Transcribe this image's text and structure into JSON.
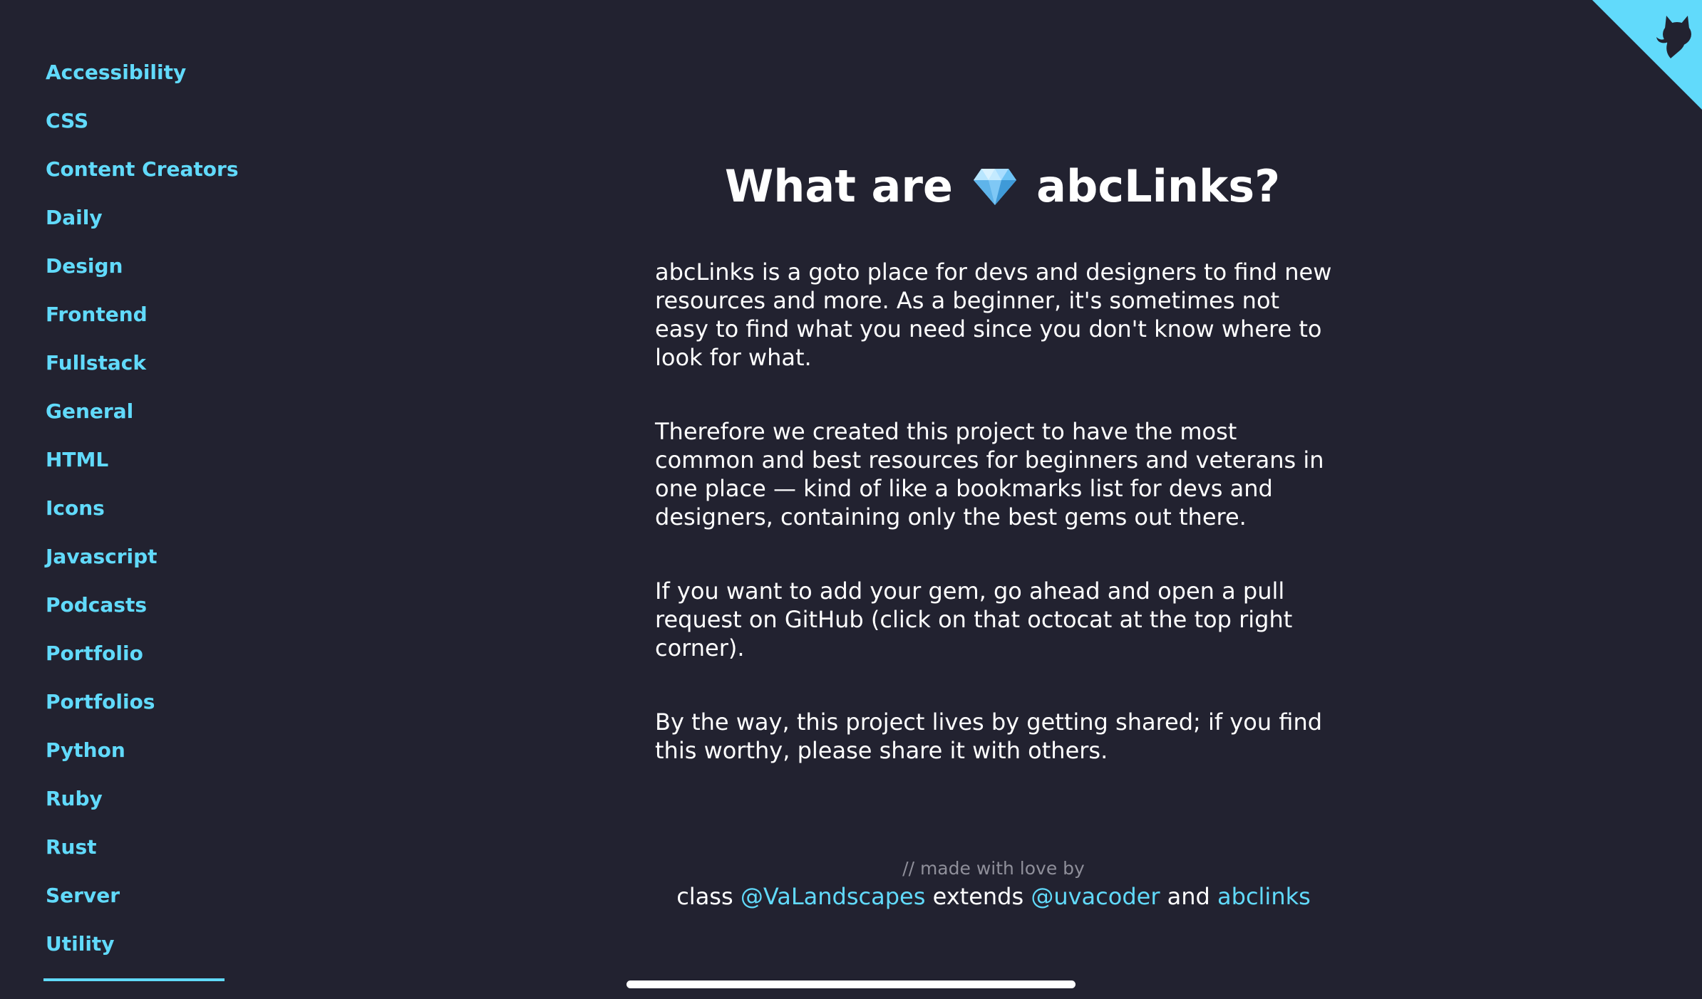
{
  "sidebar": {
    "items": [
      {
        "label": "Accessibility"
      },
      {
        "label": "CSS"
      },
      {
        "label": "Content Creators"
      },
      {
        "label": "Daily"
      },
      {
        "label": "Design"
      },
      {
        "label": "Frontend"
      },
      {
        "label": "Fullstack"
      },
      {
        "label": "General"
      },
      {
        "label": "HTML"
      },
      {
        "label": "Icons"
      },
      {
        "label": "Javascript"
      },
      {
        "label": "Podcasts"
      },
      {
        "label": "Portfolio"
      },
      {
        "label": "Portfolios"
      },
      {
        "label": "Python"
      },
      {
        "label": "Ruby"
      },
      {
        "label": "Rust"
      },
      {
        "label": "Server"
      },
      {
        "label": "Utility"
      }
    ]
  },
  "main": {
    "title_before": "What are",
    "title_after": "abcLinks?",
    "title_icon": "gem-icon",
    "paragraphs": [
      "abcLinks is a goto place for devs and designers to find new resources and more. As a beginner, it's sometimes not easy to find what you need since you don't know where to look for what.",
      "Therefore we created this project to have the most common and best resources for beginners and veterans in one place — kind of like a bookmarks list for devs and designers, containing only the best gems out there.",
      "If you want to add your gem, go ahead and open a pull request on GitHub (click on that octocat at the top right corner).",
      "By the way, this project lives by getting shared; if you find this worthy, please share it with others."
    ]
  },
  "footer": {
    "comment": "// made with love by",
    "class_kw": "class",
    "author1": "@VaLandscapes",
    "extends_kw": "extends",
    "author2": "@uvacoder",
    "and_kw": "and",
    "author3": "abclinks"
  },
  "corner": {
    "icon": "octocat-icon"
  },
  "colors": {
    "background": "#222230",
    "accent": "#61dafb",
    "text": "#ffffff",
    "muted": "#8f8f9a"
  }
}
